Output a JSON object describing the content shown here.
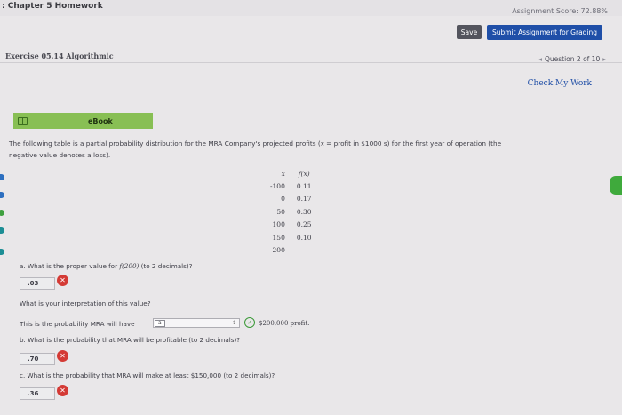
{
  "header": {
    "chapter_title": ": Chapter 5 Homework",
    "assignment_score": "Assignment Score: 72.88%",
    "save_label": "Save",
    "submit_label": "Submit Assignment for Grading"
  },
  "exercise": {
    "title": "Exercise 05.14 Algorithmic",
    "question_nav": "Question 2 of 10",
    "check_my_work": "Check My Work"
  },
  "ebook": {
    "label": "eBook",
    "icon": "book-icon"
  },
  "problem": {
    "intro_a": "The following table is a partial probability distribution for the MRA Company's projected profits (",
    "intro_var": "x",
    "intro_b": " = profit in $1000 s) for the first year of operation (the",
    "intro_line2": "negative value denotes a loss).",
    "table": {
      "headers": [
        "x",
        "f(x)"
      ],
      "rows": [
        {
          "x": "-100",
          "fx": "0.11"
        },
        {
          "x": "0",
          "fx": "0.17"
        },
        {
          "x": "50",
          "fx": "0.30"
        },
        {
          "x": "100",
          "fx": "0.25"
        },
        {
          "x": "150",
          "fx": "0.10"
        },
        {
          "x": "200",
          "fx": ""
        }
      ]
    }
  },
  "part_a": {
    "question_prefix": "a. What is the proper value for ",
    "question_func": "f(200)",
    "question_suffix": " (to 2 decimals)?",
    "answer": ".03",
    "status": "incorrect",
    "interpretation_question": "What is your interpretation of this value?",
    "interpretation_prefix": "This is the probability MRA will have",
    "interpretation_selected": "a",
    "interpretation_status": "correct",
    "interpretation_suffix": "$200,000 profit."
  },
  "part_b": {
    "question": "b. What is the probability that MRA will be profitable (to 2 decimals)?",
    "answer": ".70",
    "status": "incorrect"
  },
  "part_c": {
    "question": "c. What is the probability that MRA will make at least $150,000 (to 2 decimals)?",
    "answer": ".36",
    "status": "incorrect"
  },
  "colors": {
    "submit_button": "#1f4fa8",
    "save_button": "#53545d",
    "ebook_bar": "#88bf54",
    "incorrect": "#d43a35",
    "correct": "#3b9a38",
    "link": "#1f4ea6"
  },
  "icons": {
    "incorrect": "x-circle-icon",
    "correct": "check-circle-icon",
    "dropdown": "chevron-updown-icon",
    "prev": "chevron-left-icon",
    "next": "chevron-right-icon"
  }
}
